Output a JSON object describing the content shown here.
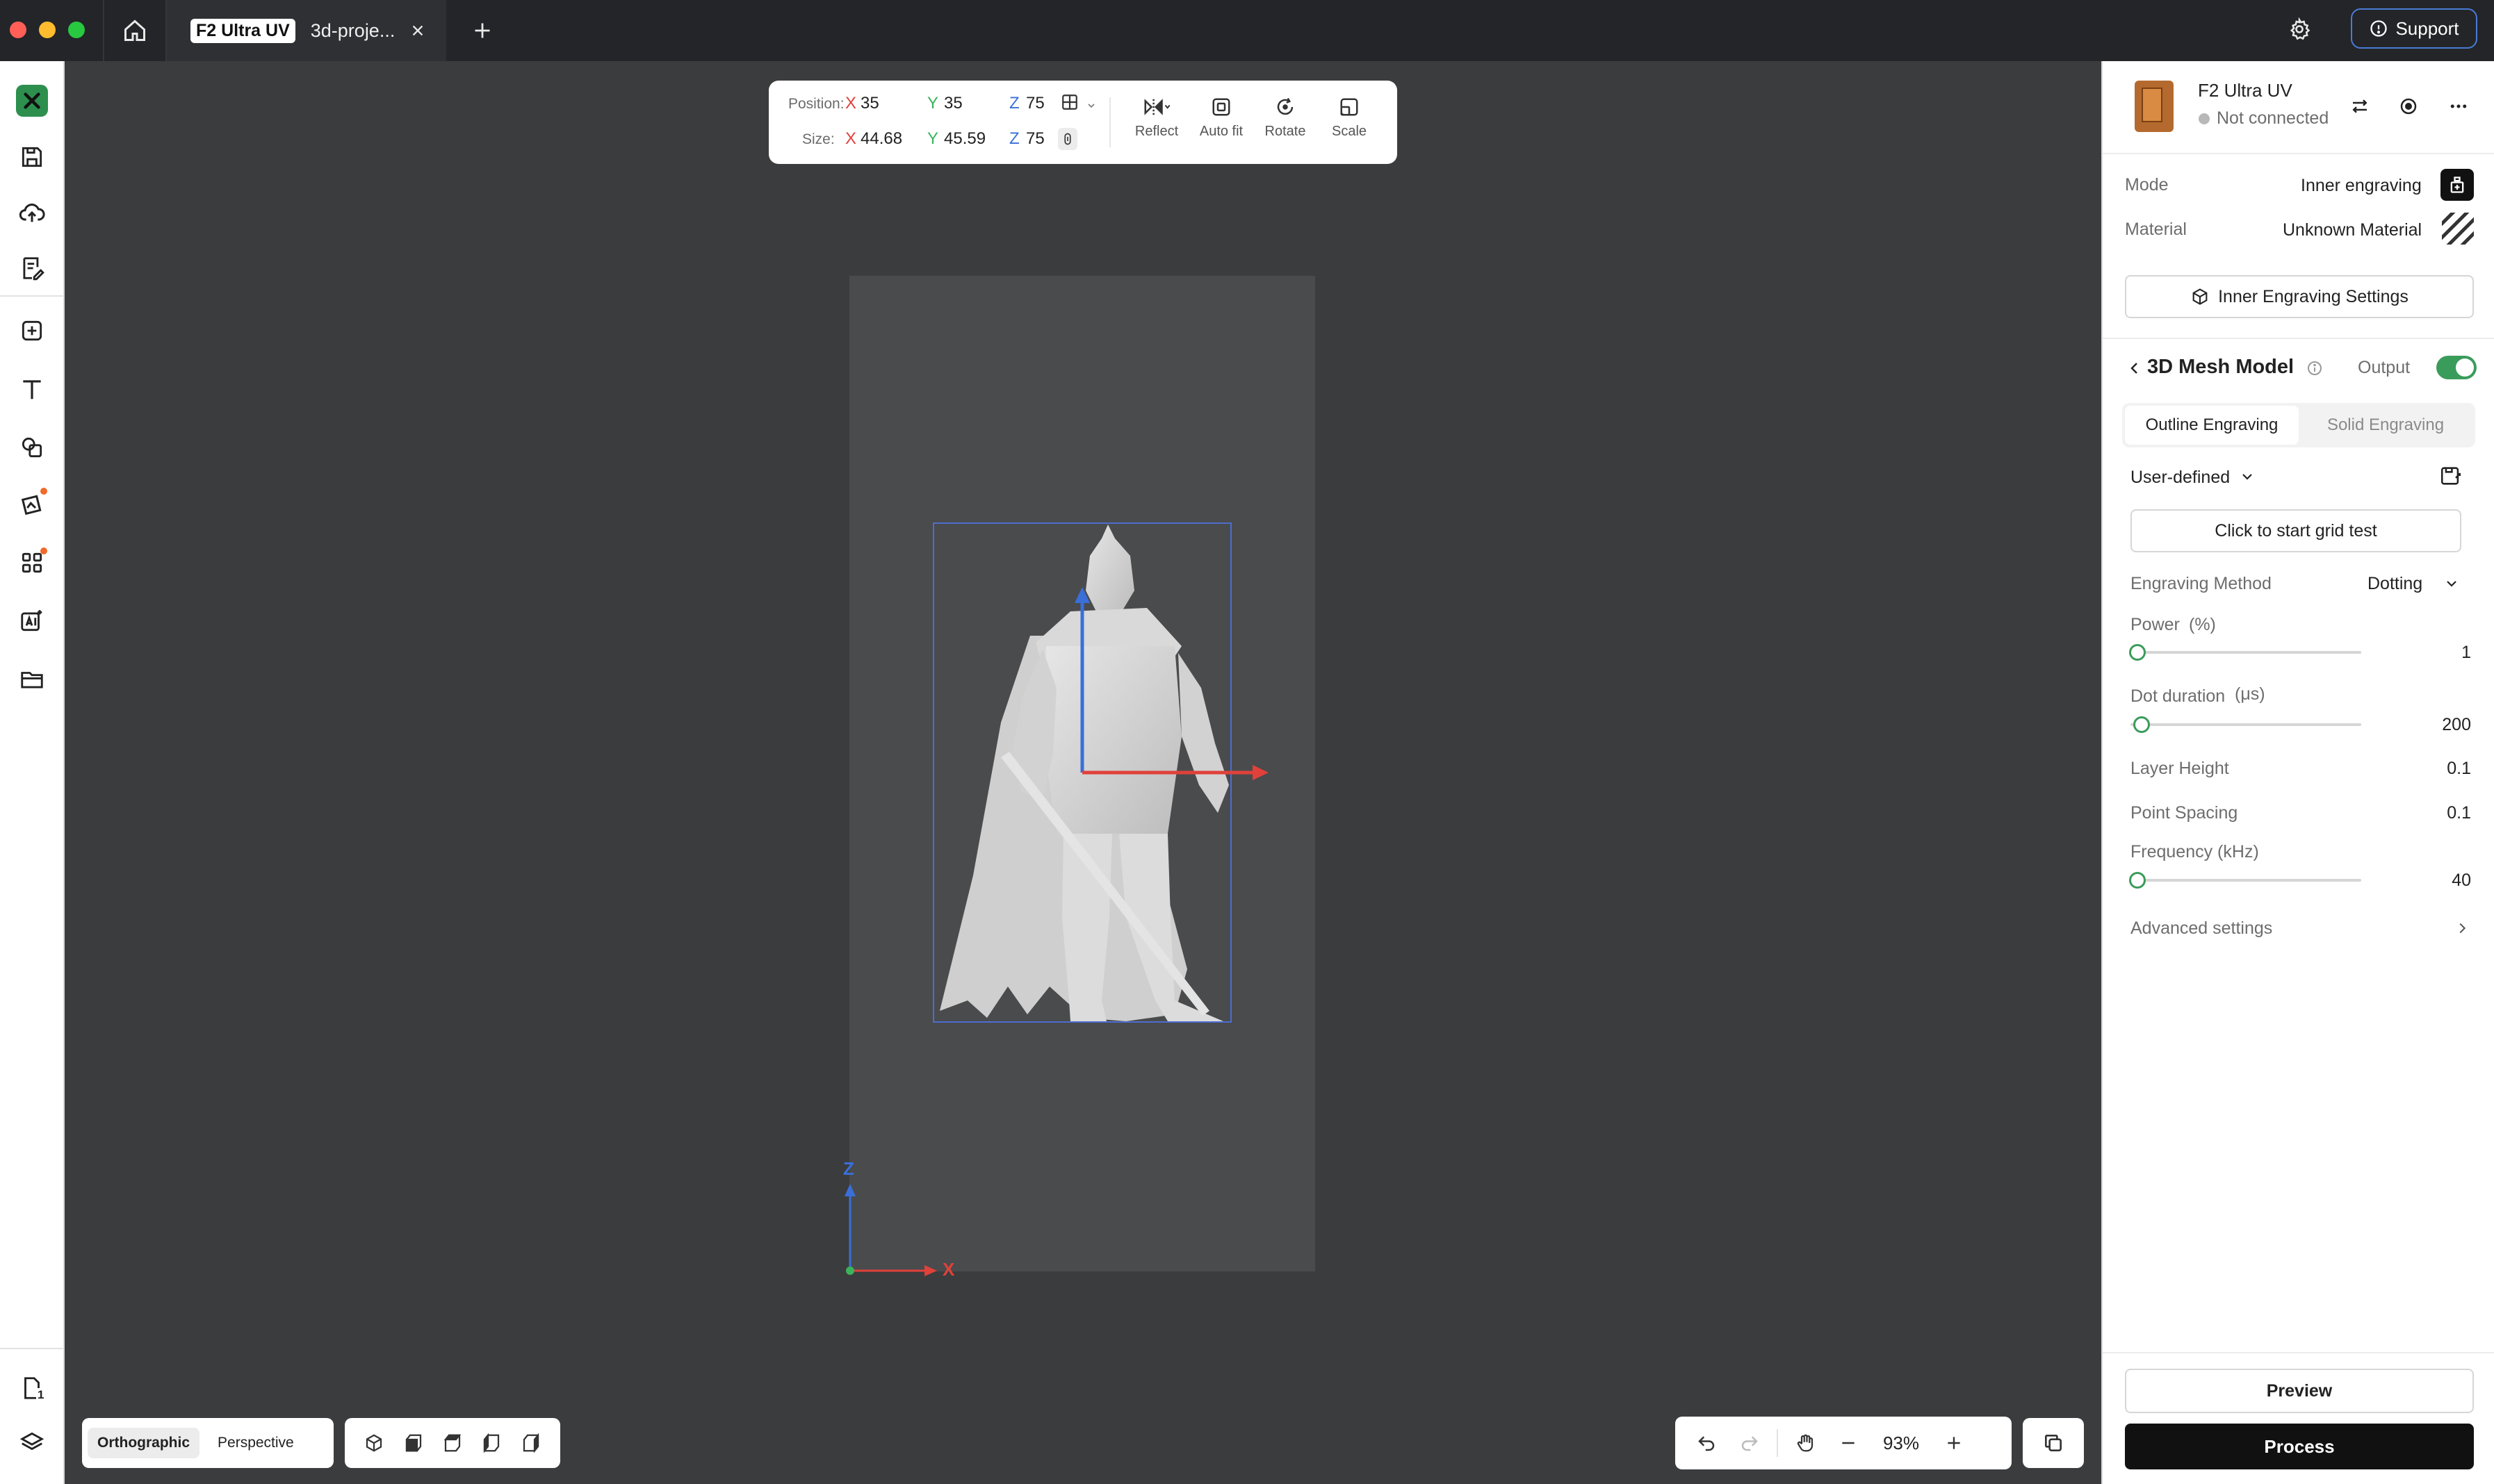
{
  "window": {
    "tab_badge": "F2 Ultra UV",
    "tab_title": "3d-proje...",
    "support_label": "Support"
  },
  "transform": {
    "position_label": "Position:",
    "size_label": "Size:",
    "pos_x_axis": "X",
    "pos_x": "35",
    "pos_y_axis": "Y",
    "pos_y": "35",
    "pos_z_axis": "Z",
    "pos_z": "75",
    "size_x_axis": "X",
    "size_x": "44.68",
    "size_y_axis": "Y",
    "size_y": "45.59",
    "size_z_axis": "Z",
    "size_z": "75",
    "tools": {
      "reflect": "Reflect",
      "auto_fit": "Auto fit",
      "rotate": "Rotate",
      "scale": "Scale"
    }
  },
  "axes": {
    "z_label": "Z",
    "x_label": "X"
  },
  "view": {
    "orthographic": "Orthographic",
    "perspective": "Perspective",
    "active": "Orthographic"
  },
  "zoom": {
    "level": "93%"
  },
  "sidebar_badge": "1",
  "device": {
    "name": "F2 Ultra UV",
    "status": "Not connected"
  },
  "settings": {
    "mode_label": "Mode",
    "mode_value": "Inner engraving",
    "material_label": "Material",
    "material_value": "Unknown Material",
    "inner_settings_button": "Inner Engraving Settings"
  },
  "object": {
    "title": "3D Mesh Model",
    "output_label": "Output",
    "output_on": true,
    "tabs": [
      "Outline Engraving",
      "Solid Engraving"
    ],
    "active_tab": 0,
    "preset": "User-defined",
    "grid_test_button": "Click to start grid test",
    "engraving_method_label": "Engraving Method",
    "engraving_method_value": "Dotting",
    "power_label": "Power",
    "power_unit": "(%)",
    "power_value": "1",
    "dot_duration_label": "Dot duration",
    "dot_duration_unit": "(μs)",
    "dot_duration_value": "200",
    "layer_height_label": "Layer Height",
    "layer_height_value": "0.1",
    "point_spacing_label": "Point Spacing",
    "point_spacing_value": "0.1",
    "frequency_label": "Frequency (kHz)",
    "frequency_value": "40",
    "advanced_label": "Advanced settings"
  },
  "actions": {
    "preview": "Preview",
    "process": "Process"
  },
  "colors": {
    "accent_green": "#3a9c5b",
    "axis_x": "#e0413a",
    "axis_y": "#3bb35c",
    "axis_z": "#3a6fd8",
    "primary_button": "#111111"
  },
  "icons": {
    "home": "home-icon",
    "close": "close-icon",
    "add": "plus-icon",
    "settings": "gear-icon",
    "support": "help-circle-icon"
  }
}
